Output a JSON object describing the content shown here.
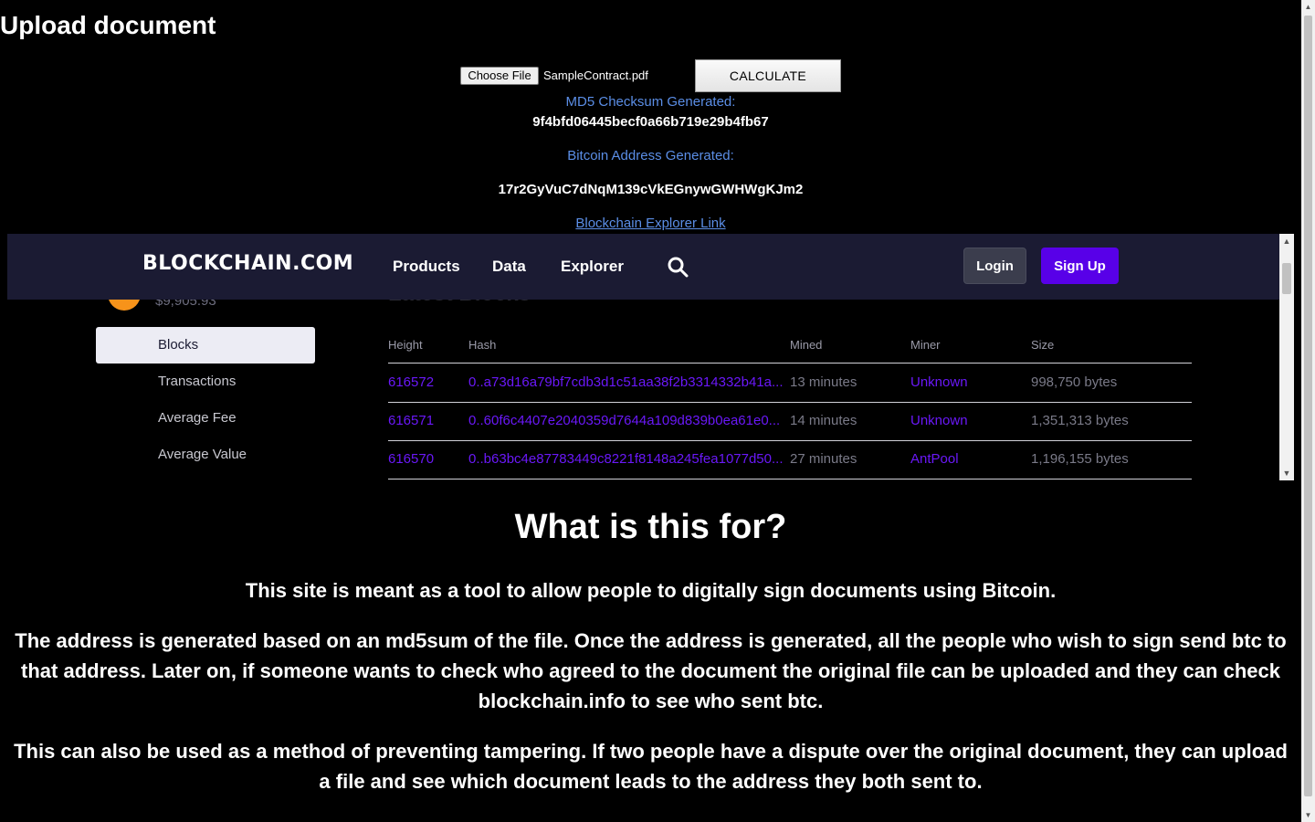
{
  "upload": {
    "title": "Upload document",
    "choose_file_label": "Choose File",
    "file_name": "SampleContract.pdf",
    "calculate_label": "CALCULATE",
    "md5_label": "MD5 Checksum Generated:",
    "md5_value": "9f4bfd06445becf0a66b719e29b4fb67",
    "address_label": "Bitcoin Address Generated:",
    "address_value": "17r2GyVuC7dNqM139cVkEGnywGWHWgKJm2",
    "explorer_link": "Blockchain Explorer Link"
  },
  "embed": {
    "logo": "BLOCKCHAIN.COM",
    "nav": [
      "Products",
      "Data",
      "Explorer"
    ],
    "login_label": "Login",
    "signup_label": "Sign Up",
    "price": "$9,905.93",
    "sidebar": [
      {
        "label": "Blocks",
        "active": true
      },
      {
        "label": "Transactions",
        "active": false
      },
      {
        "label": "Average Fee",
        "active": false
      },
      {
        "label": "Average Value",
        "active": false
      }
    ],
    "table": {
      "headers": [
        "Height",
        "Hash",
        "Mined",
        "Miner",
        "Size"
      ],
      "rows": [
        {
          "height": "616572",
          "hash": "0..a73d16a79bf7cdb3d1c51aa38f2b3314332b41a...",
          "mined": "13 minutes",
          "miner": "Unknown",
          "size": "998,750 bytes"
        },
        {
          "height": "616571",
          "hash": "0..60f6c4407e2040359d7644a109d839b0ea61e0...",
          "mined": "14 minutes",
          "miner": "Unknown",
          "size": "1,351,313 bytes"
        },
        {
          "height": "616570",
          "hash": "0..b63bc4e87783449c8221f8148a245fea1077d50...",
          "mined": "27 minutes",
          "miner": "AntPool",
          "size": "1,196,155 bytes"
        }
      ]
    },
    "colors": {
      "navbar": "#1b1b33",
      "signup": "#5800e8",
      "link": "#6a18f8",
      "coin": "#f7931a"
    }
  },
  "about": {
    "heading": "What is this for?",
    "p1": "This site is meant as a tool to allow people to digitally sign documents using Bitcoin.",
    "p2": "The address is generated based on an md5sum of the file. Once the address is generated, all the people who wish to sign send btc to that address. Later on, if someone wants to check who agreed to the document the original file can be uploaded and they can check blockchain.info to see who sent btc.",
    "p3": "This can also be used as a method of preventing tampering. If two people have a dispute over the original document, they can upload a file and see which document leads to the address they both sent to."
  }
}
